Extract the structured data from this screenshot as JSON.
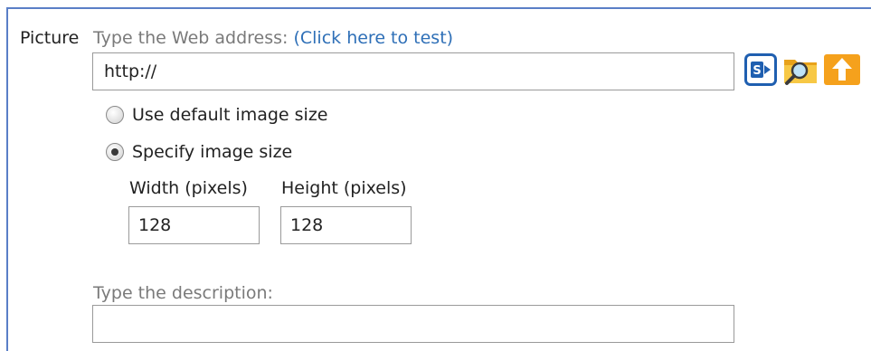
{
  "picture": {
    "field_label": "Picture",
    "address_hint": "Type the Web address: ",
    "test_link_open": "(",
    "test_link": "Click here to test",
    "test_link_close": ")",
    "url_value": "http://",
    "icons": [
      "sharepoint-browse-icon",
      "folder-search-icon",
      "upload-icon"
    ]
  },
  "image_size": {
    "options": [
      {
        "label": "Use default image size",
        "checked": false
      },
      {
        "label": "Specify image size",
        "checked": true
      }
    ],
    "width_label": "Width (pixels)",
    "height_label": "Height (pixels)",
    "width_value": "128",
    "height_value": "128"
  },
  "description": {
    "hint": "Type the description:",
    "value": ""
  },
  "colors": {
    "frame_border": "#5a7fc7",
    "link": "#2e6fb7",
    "hint_text": "#7a7a7a"
  }
}
